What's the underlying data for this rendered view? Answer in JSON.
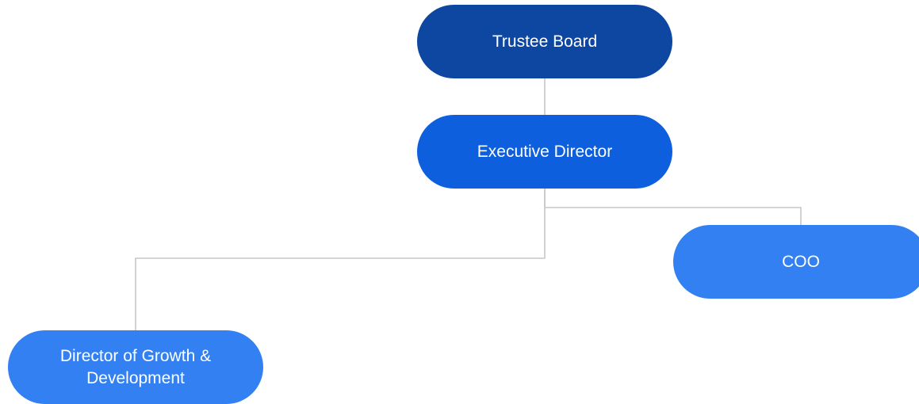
{
  "colors": {
    "level_1": "#0d47a1",
    "level_2": "#0e5fde",
    "level_3": "#3280f2",
    "connector": "#c7c7c7"
  },
  "org_chart": {
    "nodes": [
      {
        "id": "trustee_board",
        "label": "Trustee Board",
        "level": 1
      },
      {
        "id": "executive_director",
        "label": "Executive Director",
        "level": 2,
        "reports_to": "trustee_board"
      },
      {
        "id": "coo",
        "label": "COO",
        "level": 3,
        "reports_to": "executive_director"
      },
      {
        "id": "director_growth_development",
        "label": "Director of Growth &\nDevelopment",
        "level": 3,
        "reports_to": "executive_director"
      }
    ]
  }
}
